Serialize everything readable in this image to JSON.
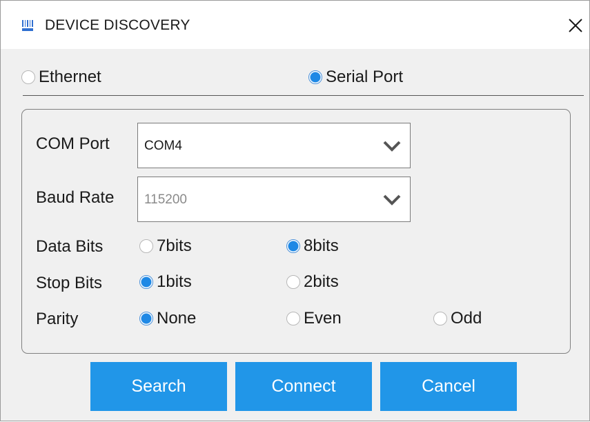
{
  "window": {
    "title": "DEVICE DISCOVERY",
    "icon": "barcode-scanner-icon",
    "close_icon": "close-icon"
  },
  "connection": {
    "options": [
      {
        "label": "Ethernet",
        "selected": false
      },
      {
        "label": "Serial Port",
        "selected": true
      }
    ]
  },
  "serial": {
    "com_port": {
      "label": "COM Port",
      "value": "COM4"
    },
    "baud_rate": {
      "label": "Baud Rate",
      "value": "115200"
    },
    "data_bits": {
      "label": "Data Bits",
      "options": [
        {
          "label": "7bits",
          "selected": false
        },
        {
          "label": "8bits",
          "selected": true
        }
      ]
    },
    "stop_bits": {
      "label": "Stop Bits",
      "options": [
        {
          "label": "1bits",
          "selected": true
        },
        {
          "label": "2bits",
          "selected": false
        }
      ]
    },
    "parity": {
      "label": "Parity",
      "options": [
        {
          "label": "None",
          "selected": true
        },
        {
          "label": "Even",
          "selected": false
        },
        {
          "label": "Odd",
          "selected": false
        }
      ]
    }
  },
  "buttons": {
    "search": "Search",
    "connect": "Connect",
    "cancel": "Cancel"
  },
  "colors": {
    "accent": "#2196e8",
    "radio_fill": "#1e88e5",
    "background": "#f0f0f0"
  }
}
